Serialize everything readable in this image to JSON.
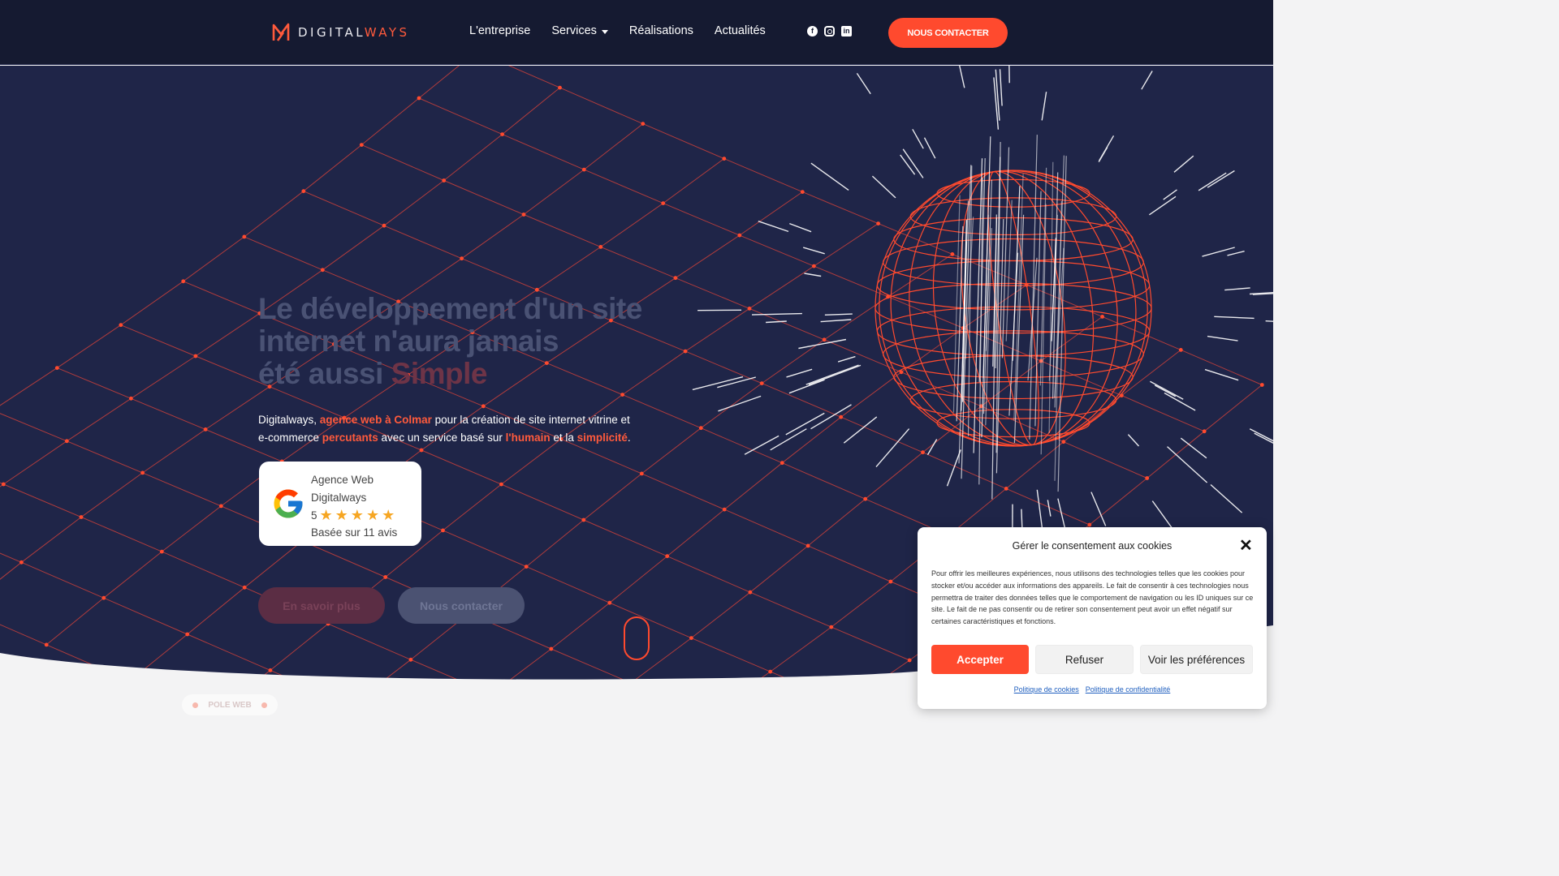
{
  "header": {
    "logo_text_main": "DIGITAL",
    "logo_text_accent": "WAYS",
    "nav": [
      {
        "label": "L'entreprise"
      },
      {
        "label": "Services"
      },
      {
        "label": "Réalisations"
      },
      {
        "label": "Actualités"
      }
    ],
    "socials": [
      "facebook-icon",
      "instagram-icon",
      "linkedin-icon"
    ],
    "cta_label": "NOUS CONTACTER"
  },
  "hero": {
    "title_line1": "Le développement d'un site",
    "title_line2": "internet n'aura jamais",
    "title_line3_prefix": "été aussi ",
    "title_line3_accent": "Simple",
    "desc": {
      "p1": "Digitalways, ",
      "h1": "agence web à Colmar",
      "p2": " pour la création de site internet vitrine et e-commerce ",
      "h2": "percutants",
      "p3": " avec un service basé sur ",
      "h3": "l'humain",
      "p4": " et la ",
      "h4": "simplicité",
      "p5": "."
    },
    "review": {
      "name": "Agence Web Digitalways",
      "score": "5",
      "stars": 5,
      "count": "Basée sur 11 avis"
    },
    "btn_more": "En savoir plus",
    "btn_contact": "Nous contacter"
  },
  "section_pill": "POLE WEB",
  "cookie": {
    "title": "Gérer le consentement aux cookies",
    "text": "Pour offrir les meilleures expériences, nous utilisons des technologies telles que les cookies pour stocker et/ou accéder aux informations des appareils. Le fait de consentir à ces technologies nous permettra de traiter des données telles que le comportement de navigation ou les ID uniques sur ce site. Le fait de ne pas consentir ou de retirer son consentement peut avoir un effet négatif sur certaines caractéristiques et fonctions.",
    "accept": "Accepter",
    "refuse": "Refuser",
    "prefs": "Voir les préférences",
    "link_cookies": "Politique de cookies",
    "link_privacy": "Politique de confidentialité"
  },
  "colors": {
    "header_bg": "#151a31",
    "hero_bg": "#1f2548",
    "accent": "#ff4a2e"
  }
}
